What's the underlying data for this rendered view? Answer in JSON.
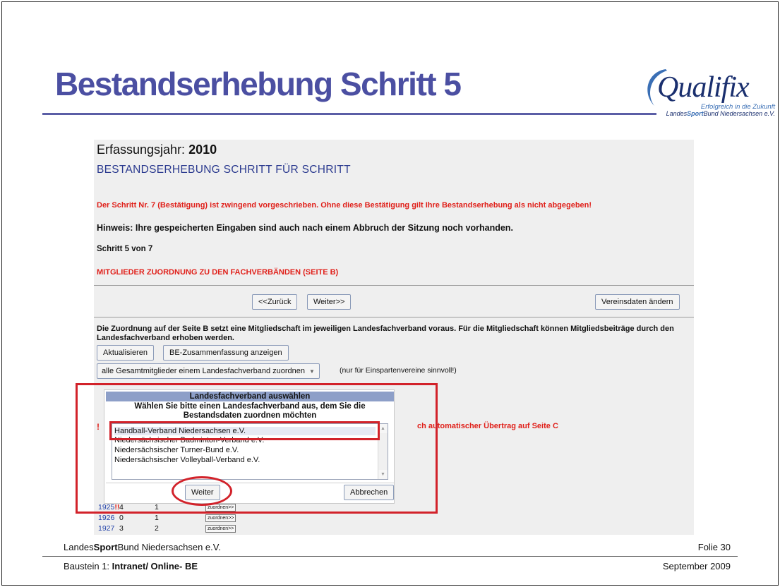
{
  "slide": {
    "title": "Bestandserhebung Schritt 5",
    "logo": {
      "word": "Qualifix",
      "tagline": "Erfolgreich in die Zukunft",
      "org_prefix": "Landes",
      "org_bold": "Sport",
      "org_suffix": "Bund Niedersachsen e.V."
    },
    "footer": {
      "org_prefix": "Landes",
      "org_bold": "Sport",
      "org_suffix": "Bund Niedersachsen e.V.",
      "folie": "Folie 30",
      "baustein_prefix": "Baustein 1: ",
      "baustein_bold": "Intranet/ Online- BE",
      "date": "September 2009"
    }
  },
  "screen": {
    "erfassungsjahr_label": "Erfassungsjahr: ",
    "erfassungsjahr_value": "2010",
    "heading": "BESTANDSERHEBUNG SCHRITT FÜR SCHRITT",
    "notice": "Der Schritt Nr. 7 (Bestätigung) ist zwingend vorgeschrieben. Ohne diese Bestätigung gilt Ihre Bestandserhebung als nicht abgegeben!",
    "hinweis": "Hinweis: Ihre gespeicherten Eingaben sind auch nach einem Abbruch der Sitzung noch vorhanden.",
    "schritt": "Schritt 5 von 7",
    "section_title": "MITGLIEDER ZUORDNUNG ZU DEN FACHVERBÄNDEN (SEITE B)",
    "nav": {
      "back": "<<Zurück",
      "next": "Weiter>>",
      "edit_club": "Vereinsdaten ändern"
    },
    "description": "Die Zuordnung auf der Seite B setzt eine Mitgliedschaft im jeweiligen Landesfachverband voraus. Für die Mitgliedschaft können Mitgliedsbeiträge durch den Landesfachverband erhoben werden.",
    "actions": {
      "refresh": "Aktualisieren",
      "summary": "BE-Zusammenfassung anzeigen",
      "assign_all": "alle Gesamtmitglieder einem Landesfachverband zuordnen",
      "assign_hint": "(nur für Einspartenvereine sinnvoll!)"
    },
    "behind_text": "ch automatischer Übertrag auf Seite C",
    "behind_excl": "!",
    "table_rows": [
      {
        "year": "1925",
        "bang": "!!",
        "a": "4",
        "b": "1",
        "button": "zuordnen>>"
      },
      {
        "year": "1926",
        "bang": "",
        "a": "0",
        "b": "1",
        "button": "zuordnen>>"
      },
      {
        "year": "1927",
        "bang": "",
        "a": "3",
        "b": "2",
        "button": "zuordnen>>"
      }
    ],
    "dialog": {
      "title": "Landesfachverband auswählen",
      "text": "Wählen Sie bitte einen Landesfachverband aus, dem Sie die Bestandsdaten zuordnen möchten",
      "options": [
        "Handball-Verband Niedersachsen e.V.",
        "Niedersächsischer Badminton-Verband e.V.",
        "Niedersächsischer Turner-Bund e.V.",
        "Niedersächsischer Volleyball-Verband e.V."
      ],
      "selected_index": 0,
      "ok": "Weiter",
      "cancel": "Abbrechen"
    }
  },
  "colors": {
    "title": "#4b4fa2",
    "accent_red": "#e0201a",
    "annotation": "#d2222a",
    "dialog_title_bg": "#8d9fc8"
  }
}
